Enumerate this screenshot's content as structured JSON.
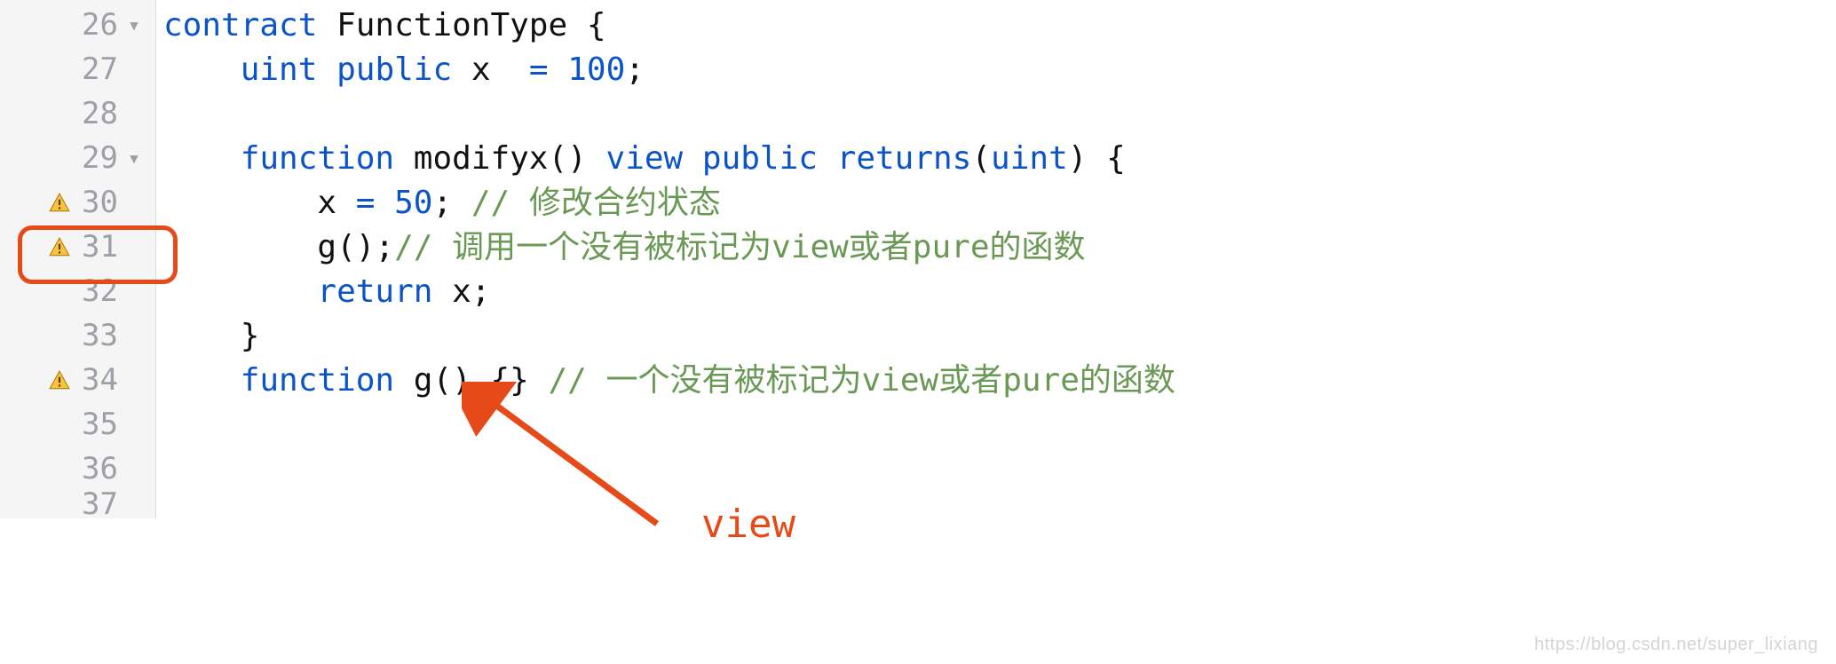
{
  "gutter": {
    "rows": [
      {
        "num": "26",
        "fold": "▾",
        "warn": false
      },
      {
        "num": "27",
        "fold": "",
        "warn": false
      },
      {
        "num": "28",
        "fold": "",
        "warn": false
      },
      {
        "num": "29",
        "fold": "▾",
        "warn": false
      },
      {
        "num": "30",
        "fold": "",
        "warn": true
      },
      {
        "num": "31",
        "fold": "",
        "warn": true
      },
      {
        "num": "32",
        "fold": "",
        "warn": false
      },
      {
        "num": "33",
        "fold": "",
        "warn": false
      },
      {
        "num": "34",
        "fold": "",
        "warn": true
      },
      {
        "num": "35",
        "fold": "",
        "warn": false
      },
      {
        "num": "36",
        "fold": "",
        "warn": false
      },
      {
        "num": "37",
        "fold": "",
        "warn": false
      }
    ]
  },
  "code": {
    "l26": {
      "a": "contract",
      "b": " FunctionType ",
      "c": "{"
    },
    "l27": {
      "a": "    ",
      "b": "uint",
      "c": " ",
      "d": "public",
      "e": " x  ",
      "f": "=",
      "g": " ",
      "h": "100",
      "i": ";"
    },
    "l28": {
      "a": ""
    },
    "l29": {
      "a": "    ",
      "b": "function",
      "c": " modifyx() ",
      "d": "view",
      "e": " ",
      "f": "public",
      "g": " ",
      "h": "returns",
      "i": "(",
      "j": "uint",
      "k": ") {"
    },
    "l30": {
      "a": "        x ",
      "b": "=",
      "c": " ",
      "d": "50",
      "e": "; ",
      "f": "// 修改合约状态"
    },
    "l31": {
      "a": "        g();",
      "b": "// 调用一个没有被标记为view或者pure的函数"
    },
    "l32": {
      "a": "        ",
      "b": "return",
      "c": " x;"
    },
    "l33": {
      "a": "    }"
    },
    "l34": {
      "a": "    ",
      "b": "function",
      "c": " g() {} ",
      "d": "// 一个没有被标记为view或者pure的函数"
    },
    "l35": {
      "a": ""
    },
    "l36": {
      "a": ""
    },
    "l37": {
      "a": ""
    }
  },
  "annotation": {
    "label": "view"
  },
  "watermark": {
    "text": "https://blog.csdn.net/super_lixiang"
  }
}
